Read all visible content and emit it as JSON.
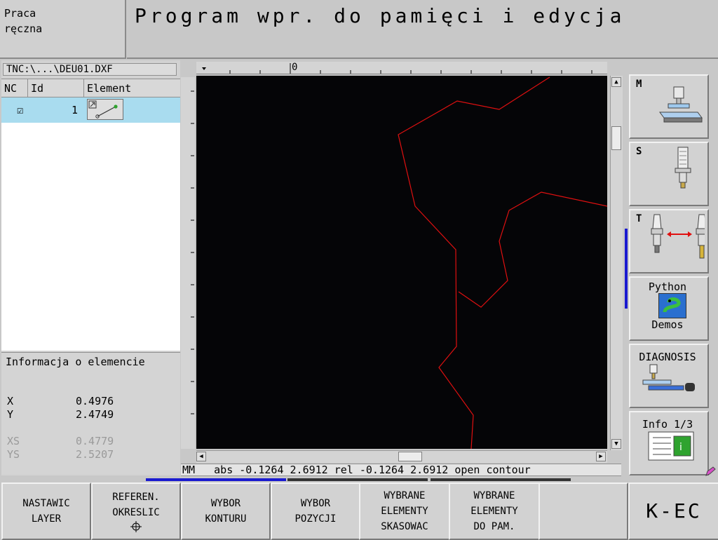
{
  "header": {
    "mode_line1": "Praca",
    "mode_line2": "ręczna",
    "title": "Program wpr. do pamięci i edycja"
  },
  "file": {
    "path": "TNC:\\...\\DEU01.DXF"
  },
  "table": {
    "columns": [
      "NC",
      "Id",
      "Element"
    ],
    "rows": [
      {
        "nc": "☑",
        "id": "1",
        "element": "line-element-icon"
      }
    ]
  },
  "info": {
    "title": "Informacja o elemencie",
    "x_label": "X",
    "x_value": "0.4976",
    "y_label": "Y",
    "y_value": "2.4749",
    "xs_label": "XS",
    "xs_value": "0.4779",
    "ys_label": "YS",
    "ys_value": "2.5207"
  },
  "ruler": {
    "zero_label": "0"
  },
  "status": {
    "text": "MM   abs -0.1264 2.6912 rel -0.1264 2.6912 open contour"
  },
  "side": {
    "m_key": "M",
    "s_key": "S",
    "t_key": "T",
    "python_line1": "Python",
    "python_line2": "Demos",
    "diagnosis": "DIAGNOSIS",
    "info": "Info 1/3"
  },
  "softkeys": {
    "sk1_line1": "NASTAWIC",
    "sk1_line2": "LAYER",
    "sk2_line1": "REFEREN.",
    "sk2_line2": "OKRESLIC",
    "sk3_line1": "WYBOR",
    "sk3_line2": "KONTURU",
    "sk4_line1": "WYBOR",
    "sk4_line2": "POZYCJI",
    "sk5_line1": "WYBRANE",
    "sk5_line2": "ELEMENTY",
    "sk5_line3": "SKASOWAC",
    "sk6_line1": "WYBRANE",
    "sk6_line2": "ELEMENTY",
    "sk6_line3": "DO PAM.",
    "kec": "K-EC"
  },
  "colors": {
    "contour": "#e01010",
    "selection": "#a9dcef",
    "canvas": "#050507",
    "marker": "#1a1ad0"
  }
}
